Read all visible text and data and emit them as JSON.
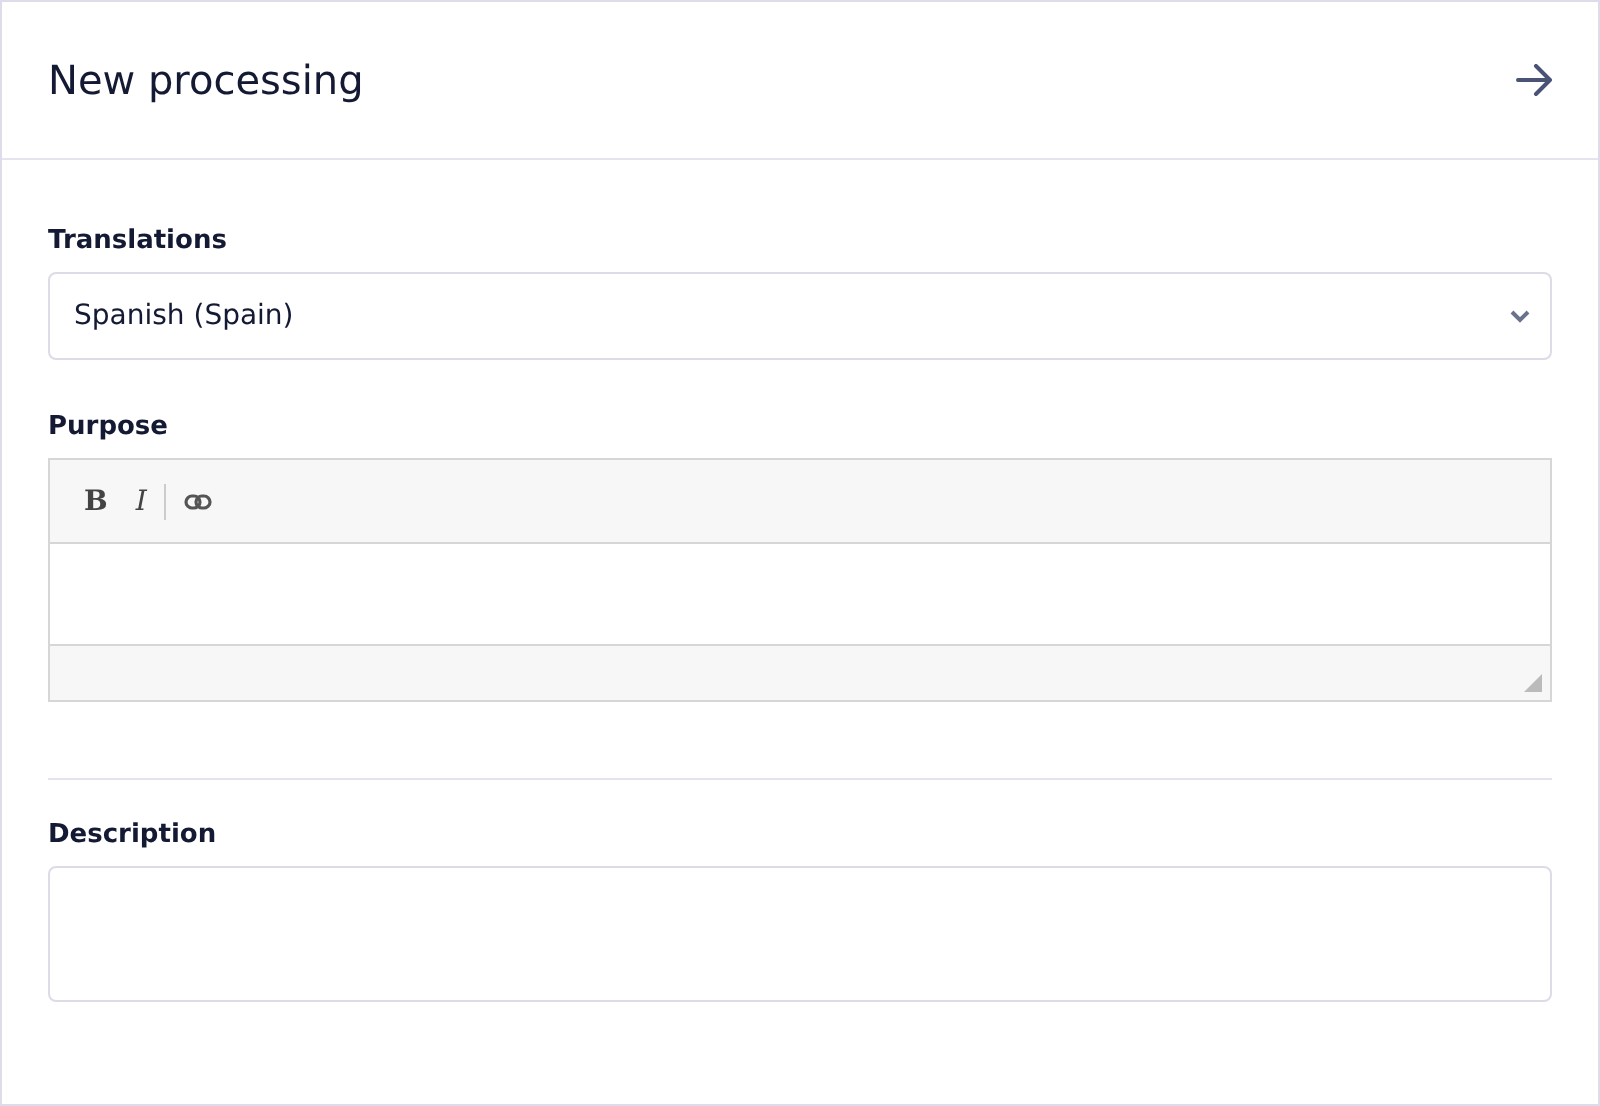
{
  "header": {
    "title": "New processing"
  },
  "translations": {
    "label": "Translations",
    "value": "Spanish (Spain)"
  },
  "purpose": {
    "label": "Purpose",
    "toolbar": [
      {
        "kind": "bold",
        "label": "B"
      },
      {
        "kind": "italic",
        "label": "I"
      },
      {
        "kind": "link"
      }
    ]
  },
  "description": {
    "label": "Description"
  }
}
